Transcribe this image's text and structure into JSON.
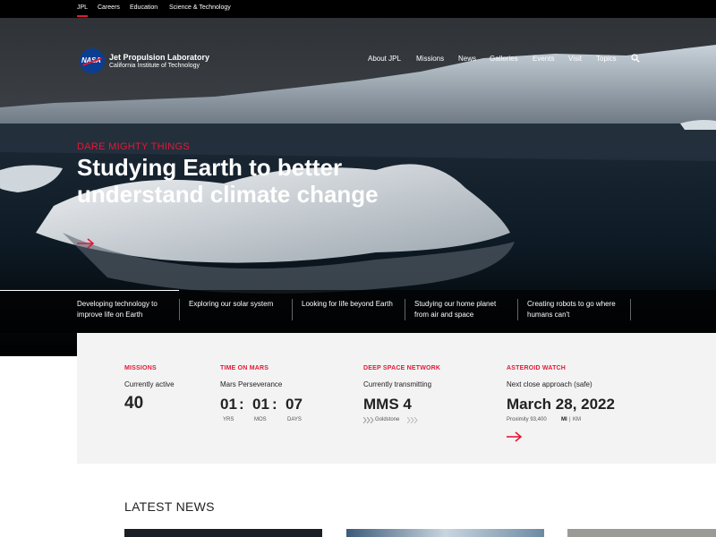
{
  "topbar": {
    "items": [
      {
        "label": "JPL",
        "active": true
      },
      {
        "label": "Careers"
      },
      {
        "label": "Education"
      },
      {
        "label": "Science & Technology"
      }
    ]
  },
  "header": {
    "logo_text": "NASA",
    "title": "Jet Propulsion Laboratory",
    "subtitle": "California Institute of Technology",
    "nav": [
      "About JPL",
      "Missions",
      "News",
      "Galleries",
      "Events",
      "Visit",
      "Topics"
    ],
    "search_icon": "search-icon"
  },
  "hero": {
    "eyebrow": "DARE MIGHTY THINGS",
    "headline": "Studying Earth to better understand climate change",
    "arrow_icon": "arrow-right-icon"
  },
  "topics": [
    "Developing technology to improve life on Earth",
    "Exploring our solar system",
    "Looking for life beyond Earth",
    "Studying our home planet from air and space",
    "Creating robots to go where humans can't"
  ],
  "stats": {
    "missions": {
      "head": "MISSIONS",
      "sub": "Currently active",
      "value": "40"
    },
    "mars": {
      "head": "TIME ON MARS",
      "sub": "Mars Perseverance",
      "yrs": "01",
      "mos": "01",
      "days": "07",
      "yrs_label": "YRS",
      "mos_label": "MOS",
      "days_label": "DAYS",
      "sep": ":"
    },
    "dsn": {
      "head": "DEEP SPACE NETWORK",
      "sub": "Currently transmitting",
      "value": "MMS 4",
      "station": "Goldstone"
    },
    "asteroid": {
      "head": "ASTEROID WATCH",
      "sub": "Next close approach (safe)",
      "value": "March 28, 2022",
      "proximity": "Proximity 93,400",
      "unit_mi": "MI",
      "unit_km": "KM",
      "unit_sep": "|"
    }
  },
  "news": {
    "title": "LATEST NEWS"
  },
  "colors": {
    "accent": "#e31937",
    "nasa_blue": "#0b3d91"
  }
}
